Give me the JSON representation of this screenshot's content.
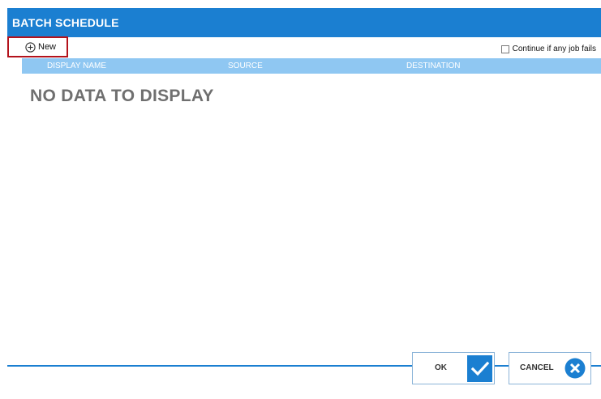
{
  "window": {
    "title": "BATCH SCHEDULE"
  },
  "toolbar": {
    "new_label": "New",
    "continue_label": "Continue if any job fails",
    "continue_checked": false
  },
  "grid": {
    "columns": [
      "DISPLAY NAME",
      "SOURCE",
      "DESTINATION"
    ],
    "empty_message": "NO DATA TO DISPLAY"
  },
  "footer": {
    "ok_label": "OK",
    "cancel_label": "CANCEL"
  },
  "icons": {
    "new": "plus-circle-icon",
    "ok": "check-icon",
    "cancel": "close-circle-icon"
  },
  "colors": {
    "primary": "#1b7fd1",
    "header": "#8fc7f2",
    "highlight": "#b3121b",
    "muted_text": "#6f6f6f"
  }
}
